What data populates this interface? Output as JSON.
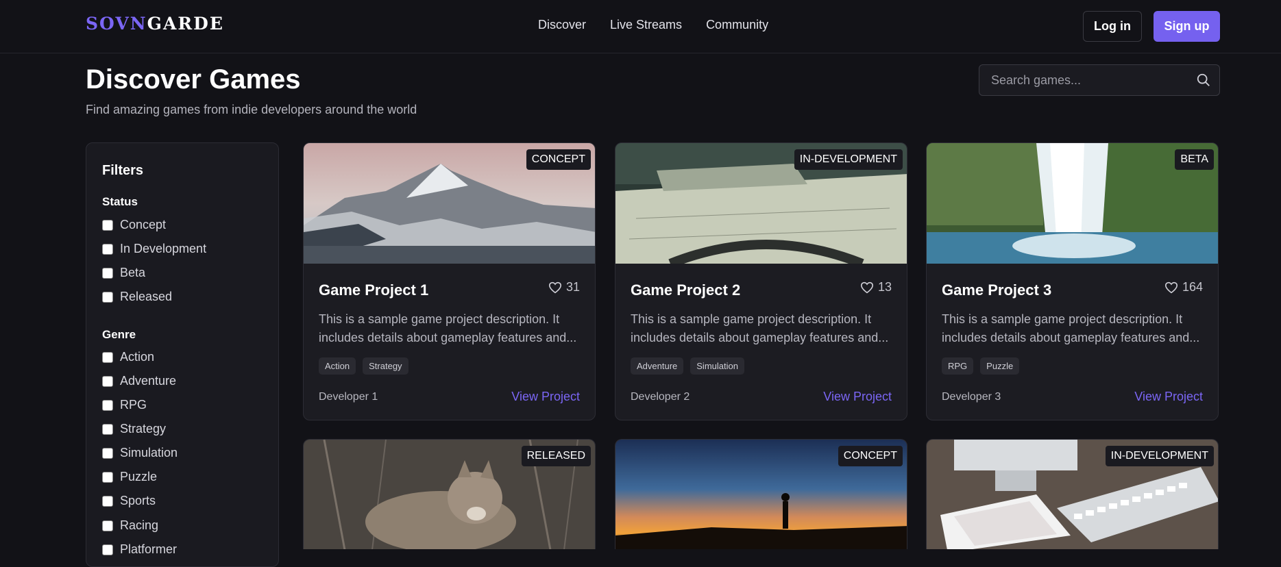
{
  "header": {
    "logo_accent": "SOVN",
    "logo_rest": "GARDE",
    "nav": [
      "Discover",
      "Live Streams",
      "Community"
    ],
    "login": "Log in",
    "signup": "Sign up"
  },
  "page": {
    "title": "Discover Games",
    "subtitle": "Find amazing games from indie developers around the world",
    "search_placeholder": "Search games..."
  },
  "filters": {
    "title": "Filters",
    "status_label": "Status",
    "status": [
      "Concept",
      "In Development",
      "Beta",
      "Released"
    ],
    "genre_label": "Genre",
    "genre": [
      "Action",
      "Adventure",
      "RPG",
      "Strategy",
      "Simulation",
      "Puzzle",
      "Sports",
      "Racing",
      "Platformer"
    ]
  },
  "cards": [
    {
      "badge": "CONCEPT",
      "title": "Game Project 1",
      "likes": "31",
      "desc": "This is a sample game project description. It includes details about gameplay features and...",
      "tags": [
        "Action",
        "Strategy"
      ],
      "dev": "Developer 1",
      "link": "View Project"
    },
    {
      "badge": "IN-DEVELOPMENT",
      "title": "Game Project 2",
      "likes": "13",
      "desc": "This is a sample game project description. It includes details about gameplay features and...",
      "tags": [
        "Adventure",
        "Simulation"
      ],
      "dev": "Developer 2",
      "link": "View Project"
    },
    {
      "badge": "BETA",
      "title": "Game Project 3",
      "likes": "164",
      "desc": "This is a sample game project description. It includes details about gameplay features and...",
      "tags": [
        "RPG",
        "Puzzle"
      ],
      "dev": "Developer 3",
      "link": "View Project"
    },
    {
      "badge": "RELEASED"
    },
    {
      "badge": "CONCEPT"
    },
    {
      "badge": "IN-DEVELOPMENT"
    }
  ]
}
